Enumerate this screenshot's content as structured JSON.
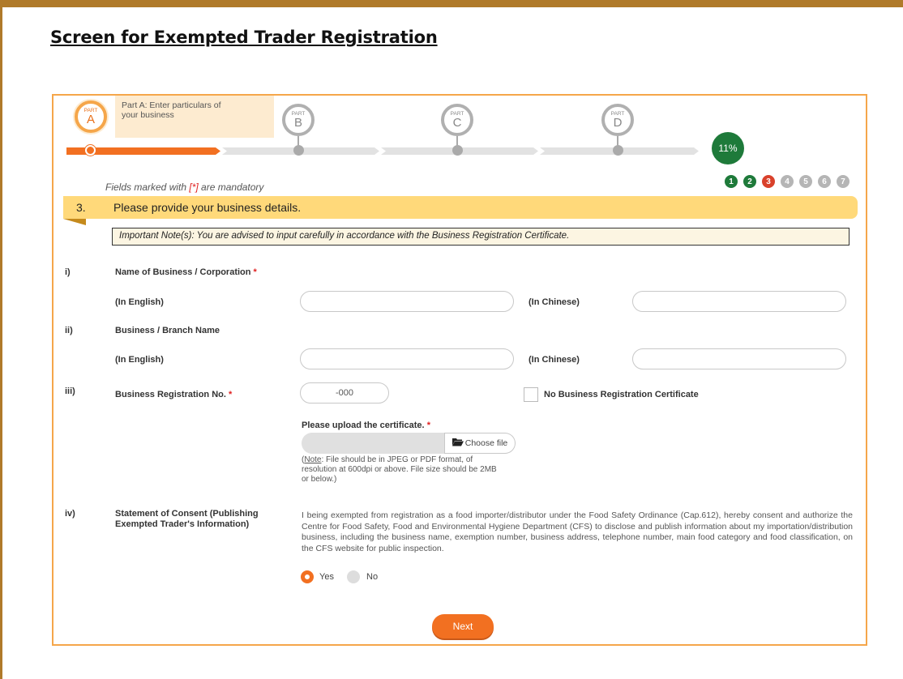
{
  "page": {
    "title": "Screen for Exempted Trader Registration"
  },
  "progress": {
    "parts": [
      {
        "prefix": "PART",
        "letter": "A",
        "description": "Part A: Enter particulars of your business",
        "state": "active"
      },
      {
        "prefix": "PART",
        "letter": "B",
        "state": "inactive"
      },
      {
        "prefix": "PART",
        "letter": "C",
        "state": "inactive"
      },
      {
        "prefix": "PART",
        "letter": "D",
        "state": "inactive"
      }
    ],
    "percent_label": "11%",
    "percent_value": 11,
    "steps": [
      {
        "label": "1",
        "state": "done"
      },
      {
        "label": "2",
        "state": "done"
      },
      {
        "label": "3",
        "state": "current"
      },
      {
        "label": "4",
        "state": "todo"
      },
      {
        "label": "5",
        "state": "todo"
      },
      {
        "label": "6",
        "state": "todo"
      },
      {
        "label": "7",
        "state": "todo"
      }
    ]
  },
  "mandatory": {
    "prefix": "Fields marked with ",
    "marker": "[*]",
    "suffix": " are mandatory"
  },
  "section": {
    "number": "3.",
    "title": "Please provide your business details.",
    "important_note": "Important Note(s): You are advised to input carefully in accordance with the Business Registration Certificate."
  },
  "fields": {
    "q1": {
      "roman": "i)",
      "label": "Name of Business / Corporation",
      "required": "*",
      "english_label": "(In English)",
      "chinese_label": "(In Chinese)",
      "english_value": "",
      "chinese_value": ""
    },
    "q2": {
      "roman": "ii)",
      "label": "Business / Branch Name",
      "english_label": "(In English)",
      "chinese_label": "(In Chinese)",
      "english_value": "",
      "chinese_value": ""
    },
    "q3": {
      "roman": "iii)",
      "label": "Business Registration No.",
      "required": "*",
      "value": "-000",
      "no_cert_label": "No Business Registration Certificate",
      "no_cert_checked": false,
      "upload_label": "Please upload the certificate.",
      "upload_required": "*",
      "choose_file_label": "Choose file",
      "note_prefix": "Note",
      "note_rest": ": File should be in JPEG or PDF format, of resolution at 600dpi or above. File size should be 2MB or below.)",
      "note_open": "("
    },
    "q4": {
      "roman": "iv)",
      "label": "Statement of Consent (Publishing Exempted Trader's Information)",
      "consent_text": "I being exempted from registration as a food importer/distributor under the Food Safety Ordinance (Cap.612), hereby consent and authorize the Centre for Food Safety, Food and Environmental Hygiene Department (CFS) to disclose and publish information about my importation/distribution business, including the business name, exemption number, business address, telephone number, main food category and food classification, on the CFS website for public inspection.",
      "yes_label": "Yes",
      "no_label": "No",
      "selected": "Yes"
    }
  },
  "actions": {
    "next_label": "Next"
  },
  "colors": {
    "accent": "#f27021",
    "done": "#1e7a3a",
    "current": "#d9412b",
    "band": "#ffd97a",
    "frame": "#b07a2a"
  }
}
